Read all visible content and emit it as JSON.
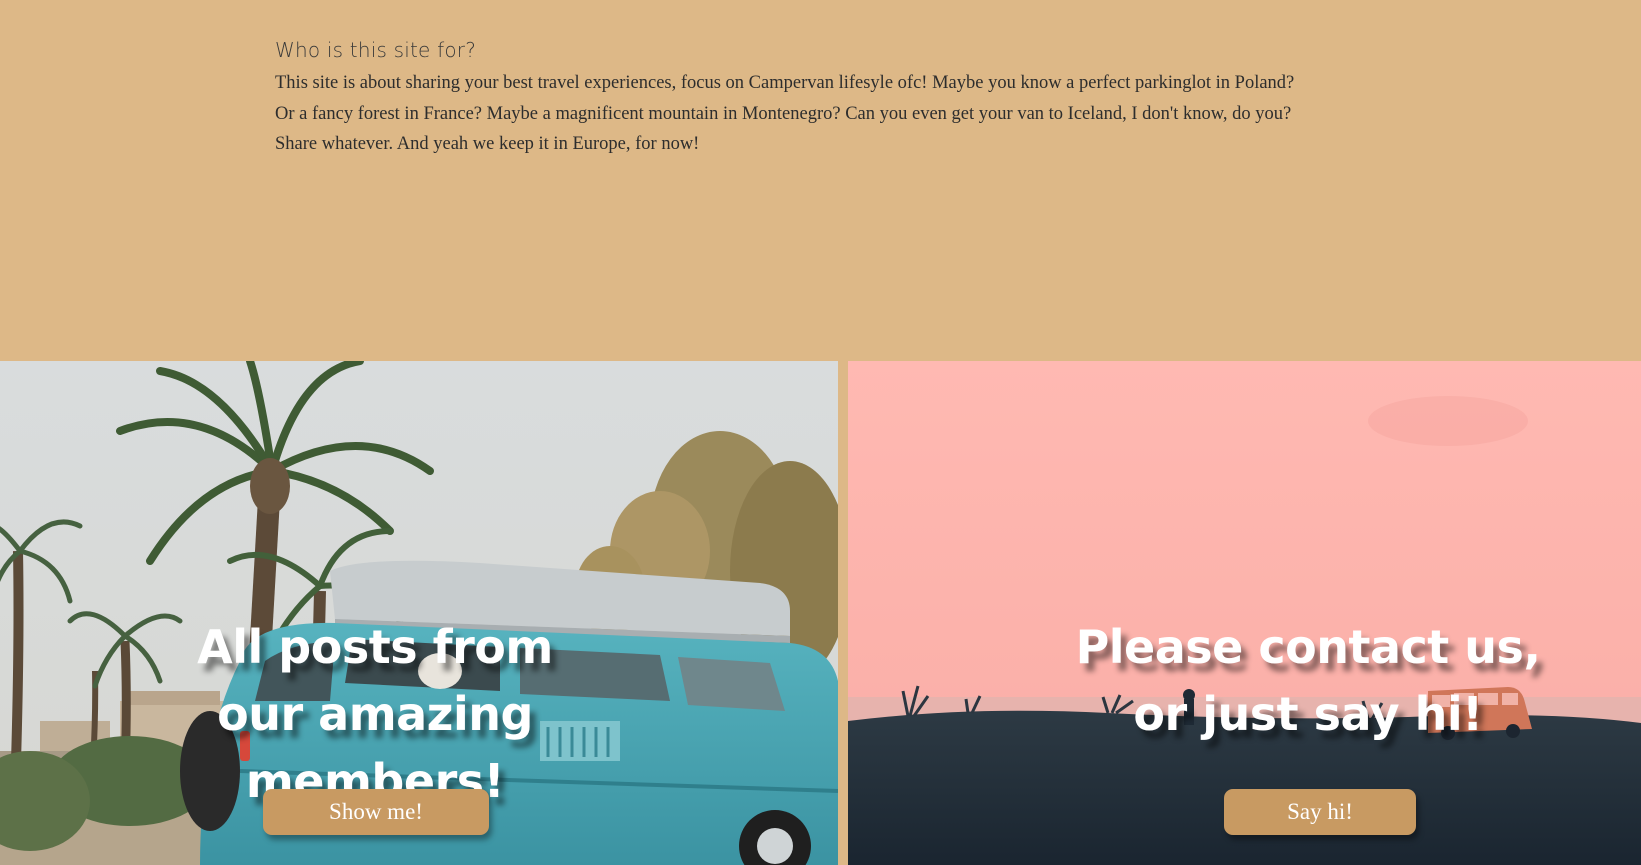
{
  "about": {
    "title": "Who is this site for?",
    "paragraph": "This site is about sharing your best travel experiences, focus on Campervan lifesyle ofc! Maybe you know a perfect parkinglot in Poland? Or a fancy forest in France? Maybe a magnificent mountain in Montenegro? Can you even get your van to Iceland, I don't know, do you?",
    "note": "Share whatever. And yeah we keep it in Europe, for now!"
  },
  "posts_panel": {
    "heading": "All posts from our amazing members!",
    "button_label": "Show me!"
  },
  "contact_panel": {
    "heading": "Please contact us, or just say hi!",
    "button_label": "Say hi!"
  },
  "colors": {
    "page_background": "#ddb887",
    "button_background": "#c89a62",
    "contact_sky": "#fdb4ae",
    "contact_ground": "#1e2a36",
    "van_body": "#4aa5b2"
  }
}
